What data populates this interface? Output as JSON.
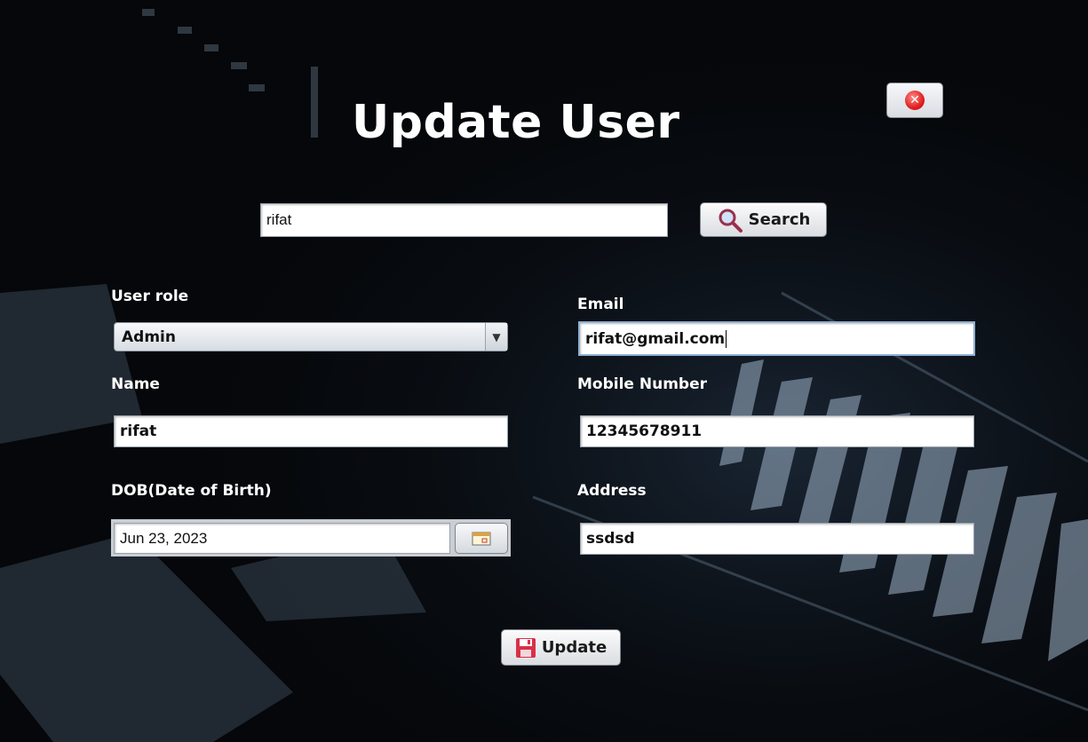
{
  "title": "Update User",
  "close_icon": "close-icon",
  "search": {
    "value": "rifat",
    "button_label": "Search",
    "icon": "magnifier-icon"
  },
  "form": {
    "user_role": {
      "label": "User role",
      "value": "Admin"
    },
    "email": {
      "label": "Email",
      "value": "rifat@gmail.com"
    },
    "name": {
      "label": "Name",
      "value": "rifat"
    },
    "mobile": {
      "label": "Mobile Number",
      "value": "12345678911"
    },
    "dob": {
      "label": "DOB(Date of Birth)",
      "value": "Jun 23, 2023"
    },
    "address": {
      "label": "Address",
      "value": "ssdsd"
    }
  },
  "update_button": {
    "label": "Update",
    "icon": "floppy-disk-icon"
  },
  "colors": {
    "background": "#05070a",
    "text": "#ffffff",
    "close_red": "#e02020"
  }
}
